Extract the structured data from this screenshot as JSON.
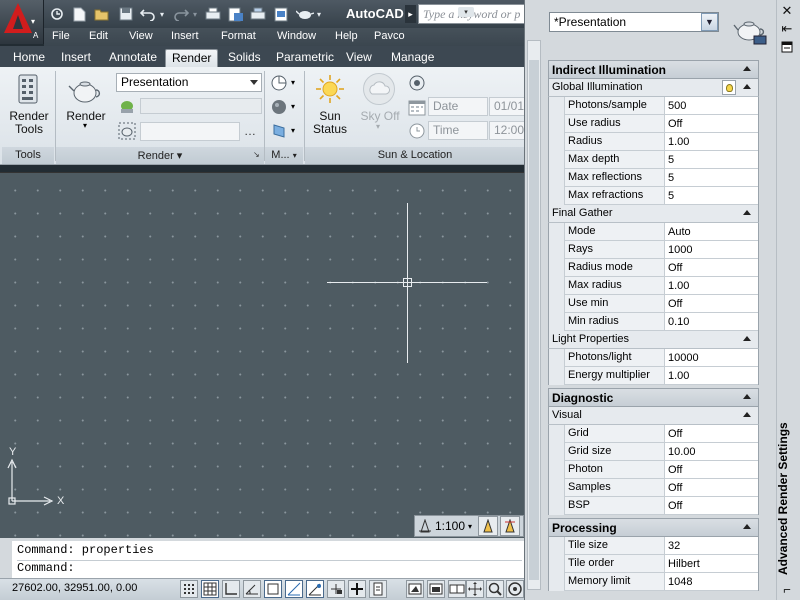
{
  "app": {
    "title": "AutoCAD",
    "app_button_letter": "A",
    "search_placeholder": "Type a keyword or p"
  },
  "quick_access": [
    "qnew-icon",
    "new-icon",
    "open-icon",
    "save-icon",
    "undo-icon",
    "redo-icon",
    "plot-icon",
    "publish-icon",
    "batch-plot-icon",
    "sheet-set-icon",
    "render-icon",
    "dropdown-icon"
  ],
  "menu": [
    "File",
    "Edit",
    "View",
    "Insert",
    "Format",
    "Window",
    "Help",
    "Pavco"
  ],
  "ribbon_tabs": [
    {
      "label": "Home",
      "active": false
    },
    {
      "label": "Insert",
      "active": false
    },
    {
      "label": "Annotate",
      "active": false
    },
    {
      "label": "Render",
      "active": true
    },
    {
      "label": "Solids",
      "active": false
    },
    {
      "label": "Parametric",
      "active": false
    },
    {
      "label": "View",
      "active": false
    },
    {
      "label": "Manage",
      "active": false
    }
  ],
  "ribbon": {
    "tools": {
      "button_label_1": "Render",
      "button_label_2": "Tools",
      "panel_title": "Tools"
    },
    "render": {
      "button_label": "Render",
      "preset_value": "Presentation",
      "panel_title": "Render",
      "panel_arrow": "▾"
    },
    "materials": {
      "panel_title": "M..."
    },
    "sun": {
      "sun_status_1": "Sun",
      "sun_status_2": "Status",
      "sky_off": "Sky Off",
      "date_label": "Date",
      "date_value": "01/01",
      "time_label": "Time",
      "time_value": "12:00",
      "panel_title": "Sun & Location"
    }
  },
  "drawing": {
    "ucs_x": "X",
    "ucs_y": "Y",
    "annotation_scale": "1:100"
  },
  "command": {
    "history": "Command: properties",
    "prompt": "Command:"
  },
  "status": {
    "coordinates": "27602.00, 32951.00, 0.00"
  },
  "palette": {
    "title": "Advanced Render Settings",
    "preset": "*Presentation",
    "sections": [
      {
        "title": "Indirect Illumination",
        "groups": [
          {
            "title": "Global Illumination",
            "bulb": true,
            "rows": [
              {
                "name": "Photons/sample",
                "value": "500"
              },
              {
                "name": "Use radius",
                "value": "Off"
              },
              {
                "name": "Radius",
                "value": "1.00"
              },
              {
                "name": "Max depth",
                "value": "5"
              },
              {
                "name": "Max reflections",
                "value": "5"
              },
              {
                "name": "Max refractions",
                "value": "5"
              }
            ]
          },
          {
            "title": "Final Gather",
            "rows": [
              {
                "name": "Mode",
                "value": "Auto"
              },
              {
                "name": "Rays",
                "value": "1000"
              },
              {
                "name": "Radius mode",
                "value": "Off"
              },
              {
                "name": "Max radius",
                "value": "1.00"
              },
              {
                "name": "Use min",
                "value": "Off"
              },
              {
                "name": "Min radius",
                "value": "0.10"
              }
            ]
          },
          {
            "title": "Light Properties",
            "rows": [
              {
                "name": "Photons/light",
                "value": "10000"
              },
              {
                "name": "Energy multiplier",
                "value": "1.00"
              }
            ]
          }
        ]
      },
      {
        "title": "Diagnostic",
        "groups": [
          {
            "title": "Visual",
            "rows": [
              {
                "name": "Grid",
                "value": "Off"
              },
              {
                "name": "Grid size",
                "value": "10.00"
              },
              {
                "name": "Photon",
                "value": "Off"
              },
              {
                "name": "Samples",
                "value": "Off"
              },
              {
                "name": "BSP",
                "value": "Off"
              }
            ]
          }
        ]
      },
      {
        "title": "Processing",
        "groups": [
          {
            "title": "",
            "rows": [
              {
                "name": "Tile size",
                "value": "32"
              },
              {
                "name": "Tile order",
                "value": "Hilbert"
              },
              {
                "name": "Memory limit",
                "value": "1048"
              }
            ]
          }
        ]
      }
    ]
  },
  "colors": {
    "drawing_bg": "#4e5b62",
    "title_bg": "#3d4852",
    "app_logo": "#d11d1d",
    "ribbon_bg": "#e4e9ed"
  }
}
